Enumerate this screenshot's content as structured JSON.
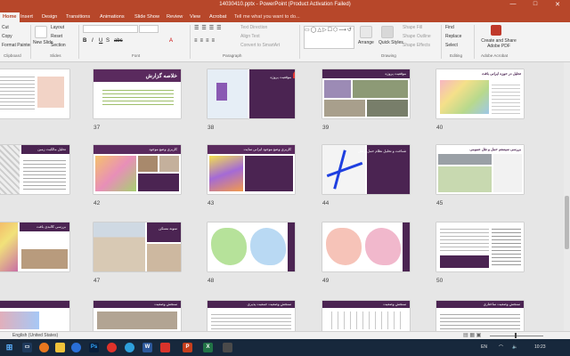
{
  "window": {
    "title": "14030410.pptx - PowerPoint (Product Activation Failed)",
    "min": "—",
    "max": "□",
    "close": "✕"
  },
  "tabs": [
    "Home",
    "Insert",
    "Design",
    "Transitions",
    "Animations",
    "Slide Show",
    "Review",
    "View",
    "Acrobat"
  ],
  "tell_me": "Tell me what you want to do...",
  "ribbon": {
    "clipboard": {
      "cut": "Cut",
      "copy": "Copy",
      "format_painter": "Format Painter",
      "group": "Clipboard"
    },
    "slides": {
      "new_slide": "New Slide",
      "layout": "Layout",
      "reset": "Reset",
      "section": "Section",
      "group": "Slides"
    },
    "font": {
      "group": "Font"
    },
    "paragraph": {
      "text_direction": "Text Direction",
      "align_text": "Align Text",
      "convert_smartart": "Convert to SmartArt",
      "group": "Paragraph"
    },
    "drawing": {
      "arrange": "Arrange",
      "quick_styles": "Quick Styles",
      "shape_fill": "Shape Fill",
      "shape_outline": "Shape Outline",
      "shape_effects": "Shape Effects",
      "group": "Drawing"
    },
    "editing": {
      "find": "Find",
      "replace": "Replace",
      "select": "Select",
      "group": "Editing"
    },
    "adobe": {
      "create_share": "Create and Share Adobe PDF",
      "group": "Adobe Acrobat"
    }
  },
  "slides": {
    "row1": [
      {
        "num": "",
        "title": ""
      },
      {
        "num": "37",
        "title": "خلاصه گزارش"
      },
      {
        "num": "38",
        "title": "موقعیت پروژه"
      },
      {
        "num": "39",
        "title": "موقعیت پروژه"
      },
      {
        "num": "40",
        "title": "تحلیل در حوزه ایرانی بافت"
      }
    ],
    "row2": [
      {
        "num": "",
        "title": "تحلیل مالکیت زمین"
      },
      {
        "num": "42",
        "title": "کاربری وضع موجود"
      },
      {
        "num": "43",
        "title": "کاربری وضع موجود ایرانی سایت"
      },
      {
        "num": "44",
        "title": "شناخت و تحلیل نظام حمل و نقل"
      },
      {
        "num": "45",
        "title": "بررسی سیستم حمل و نقل عمومی"
      }
    ],
    "row3": [
      {
        "num": "",
        "title": "بررسی کالبدی بافت"
      },
      {
        "num": "47",
        "title": "نمونه مسکن"
      },
      {
        "num": "48",
        "title": ""
      },
      {
        "num": "49",
        "title": ""
      },
      {
        "num": "50",
        "title": ""
      }
    ],
    "row4": [
      {
        "num": "",
        "title": ""
      },
      {
        "num": "",
        "title": "سنجش وضعیت"
      },
      {
        "num": "",
        "title": "سنجش وضعیت جمعیت پذیری"
      },
      {
        "num": "",
        "title": "سنجش وضعیت"
      },
      {
        "num": "",
        "title": "سنجش وضعیت ساختاری"
      }
    ]
  },
  "status": {
    "language": "English (United States)"
  },
  "taskbar": {
    "apps": [
      "Ps",
      "W",
      "P",
      "X"
    ],
    "lang": "EN",
    "time": "10:23"
  },
  "colors": {
    "accent": "#b7472a",
    "slide_bar": "#5a2a5e",
    "taskbar": "#17283c"
  }
}
